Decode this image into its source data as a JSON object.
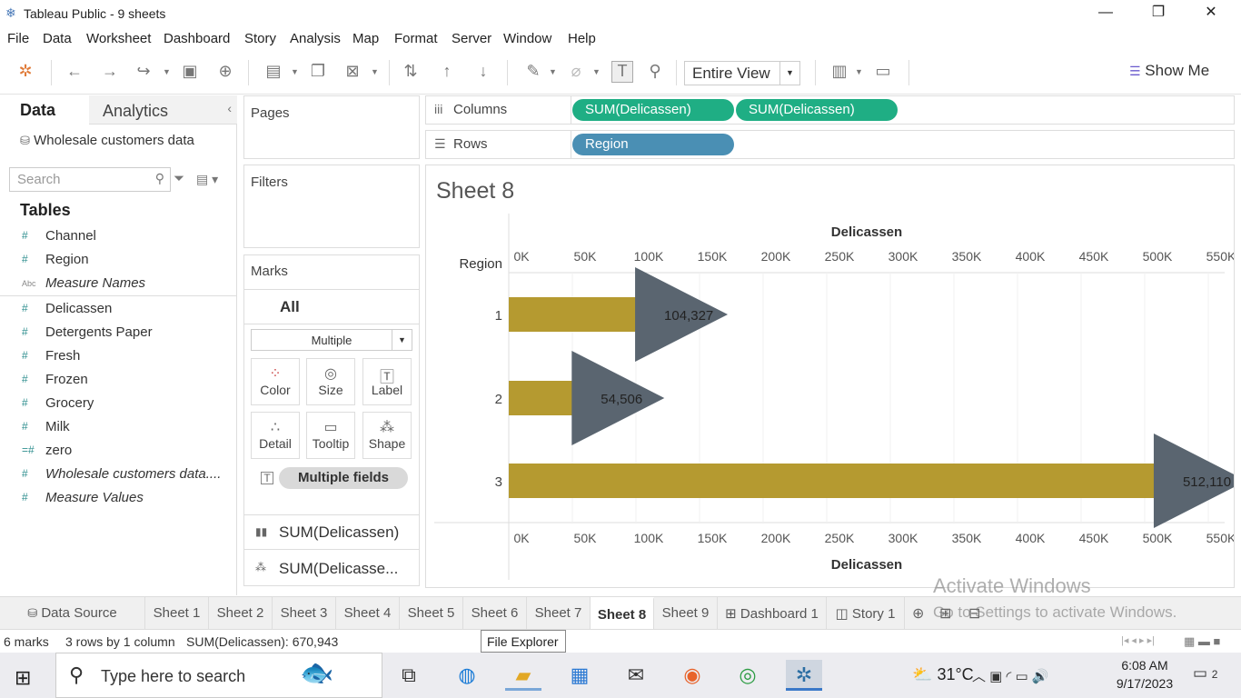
{
  "window": {
    "title": "Tableau Public - 9 sheets",
    "minimize": "—",
    "maximize": "❐",
    "close": "✕"
  },
  "menu": [
    "File",
    "Data",
    "Worksheet",
    "Dashboard",
    "Story",
    "Analysis",
    "Map",
    "Format",
    "Server",
    "Window",
    "Help"
  ],
  "toolbar": {
    "fit": "Entire View",
    "show_me": "Show Me"
  },
  "data_pane": {
    "tab_data": "Data",
    "tab_analytics": "Analytics",
    "datasource": "Wholesale customers data",
    "search_placeholder": "Search",
    "tables_header": "Tables",
    "fields": [
      {
        "icon": "#",
        "label": "Channel"
      },
      {
        "icon": "#",
        "label": "Region"
      },
      {
        "icon": "Abc",
        "label": "Measure Names"
      },
      {
        "icon": "#",
        "label": "Delicassen"
      },
      {
        "icon": "#",
        "label": "Detergents Paper"
      },
      {
        "icon": "#",
        "label": "Fresh"
      },
      {
        "icon": "#",
        "label": "Frozen"
      },
      {
        "icon": "#",
        "label": "Grocery"
      },
      {
        "icon": "#",
        "label": "Milk"
      },
      {
        "icon": "=#",
        "label": "zero"
      },
      {
        "icon": "#",
        "label": "Wholesale customers data...."
      },
      {
        "icon": "#",
        "label": "Measure Values"
      }
    ]
  },
  "cards": {
    "pages": "Pages",
    "filters": "Filters",
    "marks": "Marks",
    "marks_all": "All",
    "mark_type": "Multiple",
    "buttons": [
      "Color",
      "Size",
      "Label",
      "Detail",
      "Tooltip",
      "Shape"
    ],
    "label_pill": "Multiple fields",
    "measures": [
      "SUM(Delicassen)",
      "SUM(Delicasse..."
    ]
  },
  "shelves": {
    "columns_label": "Columns",
    "rows_label": "Rows",
    "columns": [
      "SUM(Delicassen)",
      "SUM(Delicassen)"
    ],
    "rows": [
      "Region"
    ]
  },
  "view": {
    "sheet_title": "Sheet 8"
  },
  "chart_data": {
    "type": "bar",
    "xlabel": "Delicassen",
    "ylabel": "Region",
    "categories": [
      "1",
      "2",
      "3"
    ],
    "values": [
      104327,
      54506,
      512110
    ],
    "value_labels": [
      "104,327",
      "54,506",
      "512,110"
    ],
    "xlim": [
      0,
      560000
    ],
    "ticks": [
      "0K",
      "50K",
      "100K",
      "150K",
      "200K",
      "250K",
      "300K",
      "350K",
      "400K",
      "450K",
      "500K",
      "550K"
    ],
    "tick_values": [
      0,
      50000,
      100000,
      150000,
      200000,
      250000,
      300000,
      350000,
      400000,
      450000,
      500000,
      550000
    ],
    "bar_color": "#b59a30",
    "shape_color": "#5a6570",
    "grid": true
  },
  "sheet_tabs": [
    "Data Source",
    "Sheet 1",
    "Sheet 2",
    "Sheet 3",
    "Sheet 4",
    "Sheet 5",
    "Sheet 6",
    "Sheet 7",
    "Sheet 8",
    "Sheet 9",
    "Dashboard 1",
    "Story 1"
  ],
  "active_tab": "Sheet 8",
  "status": {
    "marks": "6 marks",
    "dims": "3 rows by 1 column",
    "sum": "SUM(Delicassen): 670,943"
  },
  "tooltip": "File Explorer",
  "watermark": {
    "line1": "Activate Windows",
    "line2": "Go to Settings to activate Windows."
  },
  "taskbar": {
    "search_placeholder": "Type here to search",
    "weather": "31°C",
    "time": "6:08 AM",
    "date": "9/17/2023",
    "notifications": "2"
  }
}
